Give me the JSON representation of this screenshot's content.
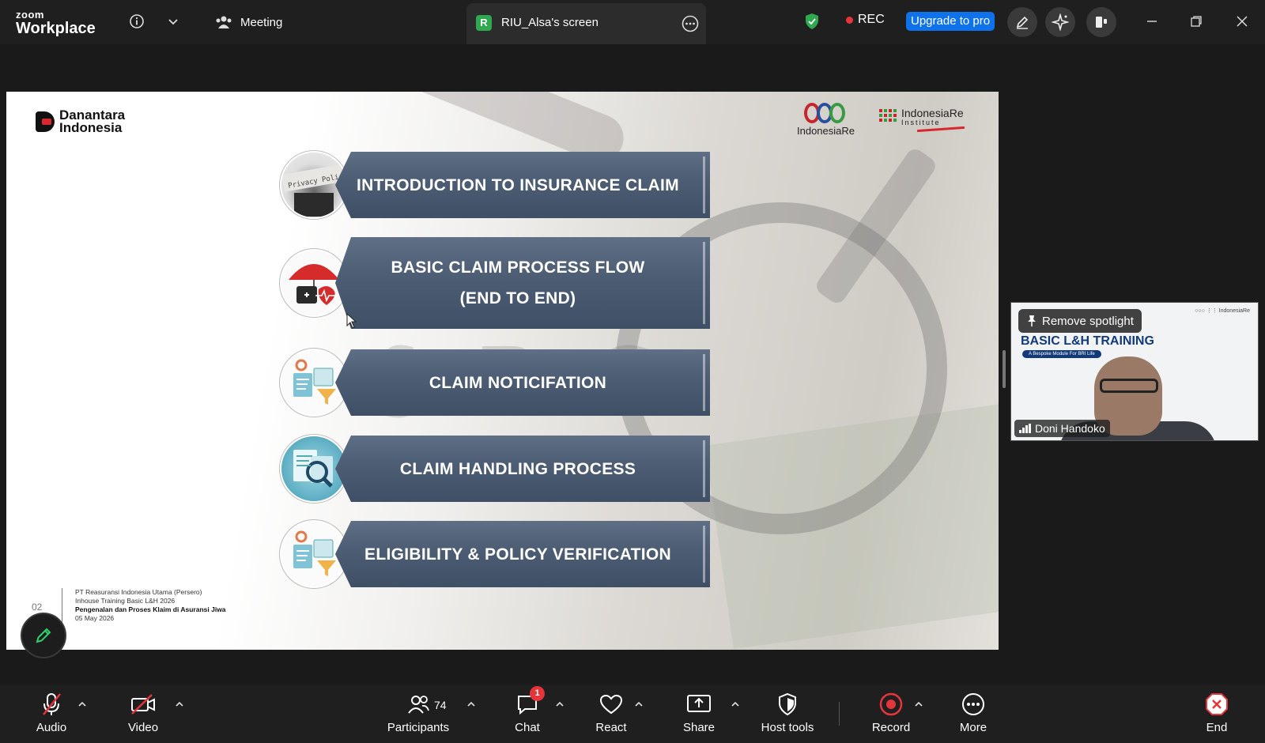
{
  "app": {
    "brand_line1": "zoom",
    "brand_line2": "Workplace"
  },
  "topbar": {
    "meeting_tab": "Meeting",
    "share_tab_badge": "R",
    "share_tab_title": "RIU_Alsa's screen",
    "rec_label": "REC",
    "upgrade_label": "Upgrade to pro"
  },
  "slide": {
    "brand_left_line1": "Danantara",
    "brand_left_line2": "Indonesia",
    "brand_right_1": "IndonesiaRe",
    "brand_right_2_line1": "IndonesiaRe",
    "brand_right_2_line2": "Institute",
    "page_number": "02",
    "footer": {
      "line1": "PT Reasuransi Indonesia Utama (Persero)",
      "line2": "Inhouse Training Basic L&H 2026",
      "line3": "Pengenalan dan Proses Klaim di Asuransi Jiwa",
      "line4": "05  May 2026"
    },
    "agenda": [
      {
        "label": "INTRODUCTION TO INSURANCE CLAIM",
        "thumb_icon": "privacy-policy-icon"
      },
      {
        "label": "BASIC CLAIM PROCESS FLOW\n(END TO END)",
        "thumb_icon": "umbrella-medical-icon"
      },
      {
        "label": "CLAIM NOTICIFATION",
        "thumb_icon": "claims-process-icon"
      },
      {
        "label": "CLAIM HANDLING PROCESS",
        "thumb_icon": "magnifier-docs-icon"
      },
      {
        "label": "ELIGIBILITY & POLICY VERIFICATION",
        "thumb_icon": "claims-process-icon"
      }
    ]
  },
  "video": {
    "spotlight_button": "Remove spotlight",
    "participant_name": "Doni Handoko",
    "bg_title": "BASIC L&H TRAINING",
    "bg_subtitle": "A Bespoke Module For BRI Life"
  },
  "toolbar": {
    "audio": "Audio",
    "video": "Video",
    "participants": "Participants",
    "participants_count": "74",
    "chat": "Chat",
    "chat_badge": "1",
    "react": "React",
    "share": "Share",
    "host_tools": "Host tools",
    "record": "Record",
    "more": "More",
    "end": "End"
  },
  "colors": {
    "accent_blue": "#0e72ed",
    "rec_red": "#e5353a",
    "shield_green": "#2fa84f",
    "banner": "#4d5e75"
  }
}
